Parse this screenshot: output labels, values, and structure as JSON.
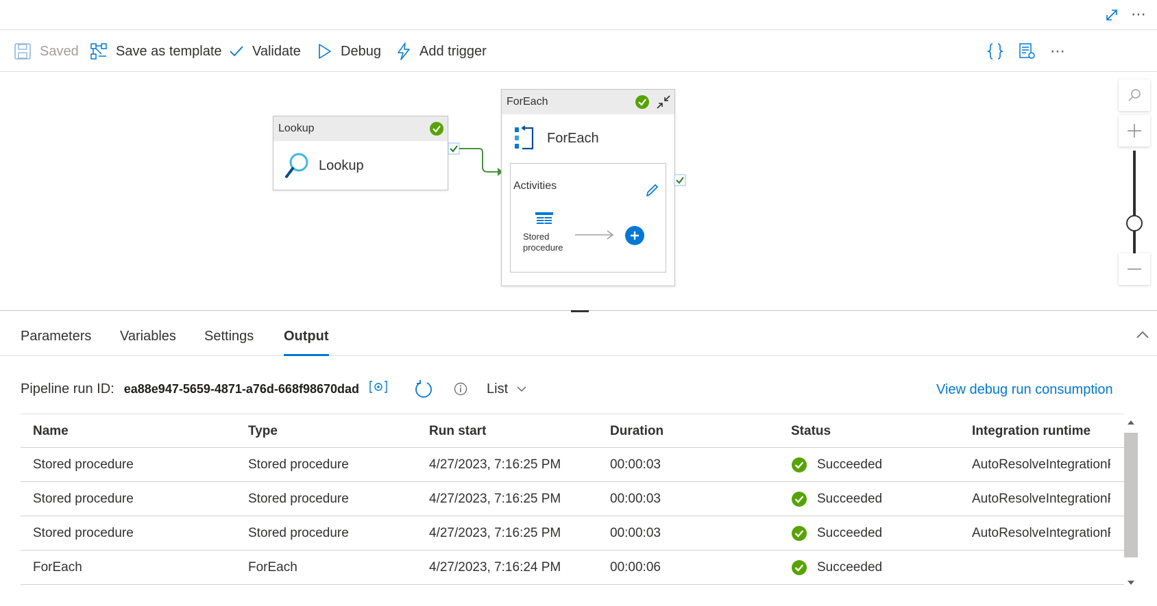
{
  "toolbar": {
    "saved": "Saved",
    "save_template": "Save as template",
    "validate": "Validate",
    "debug": "Debug",
    "add_trigger": "Add trigger"
  },
  "canvas": {
    "lookup": {
      "header": "Lookup",
      "label": "Lookup"
    },
    "foreach": {
      "header": "ForEach",
      "label": "ForEach",
      "activities_title": "Activities",
      "inner_activity_line1": "Stored",
      "inner_activity_line2": "procedure"
    }
  },
  "tabs": [
    "Parameters",
    "Variables",
    "Settings",
    "Output"
  ],
  "active_tab": "Output",
  "output": {
    "run_id_label": "Pipeline run ID:",
    "run_id": "ea88e947-5659-4871-a76d-668f98670dad",
    "view_mode": "List",
    "consumption_link": "View debug run consumption",
    "columns": [
      "Name",
      "Type",
      "Run start",
      "Duration",
      "Status",
      "Integration runtime"
    ],
    "rows": [
      {
        "name": "Stored procedure",
        "type": "Stored procedure",
        "run_start": "4/27/2023, 7:16:25 PM",
        "duration": "00:00:03",
        "status": "Succeeded",
        "runtime": "AutoResolveIntegrationR"
      },
      {
        "name": "Stored procedure",
        "type": "Stored procedure",
        "run_start": "4/27/2023, 7:16:25 PM",
        "duration": "00:00:03",
        "status": "Succeeded",
        "runtime": "AutoResolveIntegrationR"
      },
      {
        "name": "Stored procedure",
        "type": "Stored procedure",
        "run_start": "4/27/2023, 7:16:25 PM",
        "duration": "00:00:03",
        "status": "Succeeded",
        "runtime": "AutoResolveIntegrationR"
      },
      {
        "name": "ForEach",
        "type": "ForEach",
        "run_start": "4/27/2023, 7:16:24 PM",
        "duration": "00:00:06",
        "status": "Succeeded",
        "runtime": ""
      }
    ]
  },
  "colors": {
    "accent": "#0078d4",
    "success": "#57a300",
    "edge": "#4a8f3c"
  }
}
